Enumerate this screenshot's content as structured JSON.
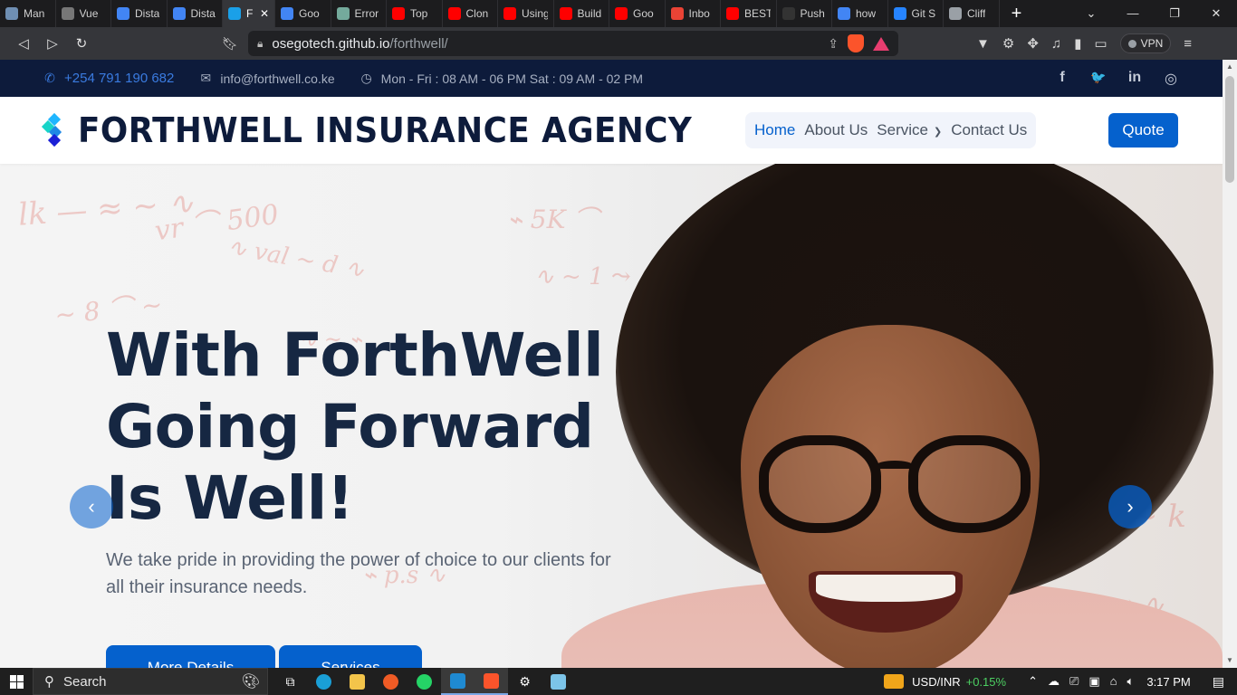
{
  "browser": {
    "tabs": [
      {
        "label": "Man",
        "icon": "figure-icon",
        "color": "#6f8fb3"
      },
      {
        "label": "Vue",
        "icon": "profile-photo-icon",
        "color": "#777777"
      },
      {
        "label": "Dista",
        "icon": "google-icon",
        "color": "#4285f4"
      },
      {
        "label": "Dista",
        "icon": "google-icon",
        "color": "#4285f4"
      },
      {
        "label": "F",
        "icon": "forthwell-icon",
        "color": "#1aa0e8",
        "active": true
      },
      {
        "label": "Goo",
        "icon": "google-icon",
        "color": "#4285f4"
      },
      {
        "label": "Error",
        "icon": "chatgpt-icon",
        "color": "#74aa9c"
      },
      {
        "label": "Top",
        "icon": "youtube-icon",
        "color": "#ff0000"
      },
      {
        "label": "Clon",
        "icon": "youtube-icon",
        "color": "#ff0000"
      },
      {
        "label": "Using",
        "icon": "youtube-icon",
        "color": "#ff0000"
      },
      {
        "label": "Build",
        "icon": "youtube-icon",
        "color": "#ff0000"
      },
      {
        "label": "Goo",
        "icon": "youtube-icon",
        "color": "#ff0000"
      },
      {
        "label": "Inbo",
        "icon": "gmail-icon",
        "color": "#ea4335"
      },
      {
        "label": "BEST",
        "icon": "youtube-icon",
        "color": "#ff0000"
      },
      {
        "label": "Push",
        "icon": "pushup-icon",
        "color": "#333333"
      },
      {
        "label": "how",
        "icon": "google-icon",
        "color": "#4285f4"
      },
      {
        "label": "Git S",
        "icon": "atlassian-icon",
        "color": "#2684ff"
      },
      {
        "label": "Cliff",
        "icon": "globe-icon",
        "color": "#9aa0a6"
      }
    ],
    "close_glyph": "✕",
    "new_tab_glyph": "+",
    "url_host": "osegotech.github.io",
    "url_path": "/forthwell/",
    "vpn_label": "VPN"
  },
  "site": {
    "contact": {
      "phone": "+254 791 190 682",
      "email": "info@forthwell.co.ke",
      "hours": "Mon - Fri : 08 AM - 06 PM Sat : 09 AM - 02 PM"
    },
    "socials": [
      "facebook-icon",
      "twitter-icon",
      "linkedin-icon",
      "instagram-icon"
    ],
    "social_glyphs": [
      "f",
      "🐦",
      "in",
      "◎"
    ],
    "brand": "FORTHWELL INSURANCE AGENCY",
    "nav": {
      "home": "Home",
      "about": "About Us",
      "service": "Service",
      "contact": "Contact Us",
      "quote": "Quote"
    },
    "hero": {
      "title_lines": [
        "With ForthWell",
        "Going Forward",
        "Is Well!"
      ],
      "subtitle": "We take pride in providing the power of choice to our clients for all their insurance needs.",
      "btn_more": "More Details",
      "btn_service": "Services"
    },
    "colors": {
      "primary": "#0561cd",
      "navy": "#0d1b3b"
    }
  },
  "taskbar": {
    "search_label": "Search",
    "ticker_pair": "USD/INR",
    "ticker_change": "+0.15%",
    "time": "3:17 PM"
  }
}
